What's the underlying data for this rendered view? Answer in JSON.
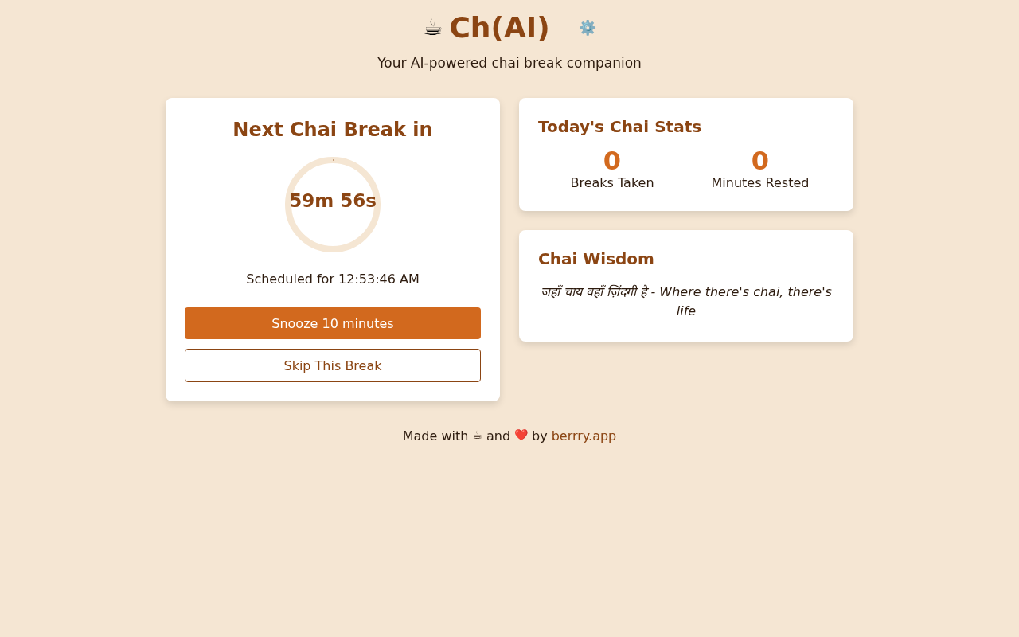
{
  "header": {
    "logo": "☕",
    "title": "Ch(AI)",
    "settings": "⚙️",
    "tagline": "Your AI-powered chai break companion"
  },
  "timer": {
    "heading": "Next Chai Break in",
    "countdown": "59m 56s",
    "level": 0.003,
    "scheduled": "Scheduled for 12:53:46 AM",
    "buttons": [
      {
        "label": "Snooze 10 minutes",
        "kind": "primary"
      },
      {
        "label": "Skip This Break",
        "kind": "outline"
      }
    ]
  },
  "stats": {
    "heading": "Today's Chai Stats",
    "items": [
      {
        "value": "0",
        "label": "Breaks Taken"
      },
      {
        "value": "0",
        "label": "Minutes Rested"
      }
    ]
  },
  "wisdom": {
    "heading": "Chai Wisdom",
    "quote": "जहाँ चाय वहाँ ज़िंदगी है - Where there's chai, there's life"
  },
  "footer": {
    "parts": [
      {
        "kind": "text",
        "text": "Made with"
      },
      {
        "kind": "emoji",
        "text": "☕"
      },
      {
        "kind": "text",
        "text": "and"
      },
      {
        "kind": "emoji",
        "text": "❤️"
      },
      {
        "kind": "text",
        "text": "by"
      },
      {
        "kind": "link",
        "text": "berrry.app"
      }
    ]
  }
}
